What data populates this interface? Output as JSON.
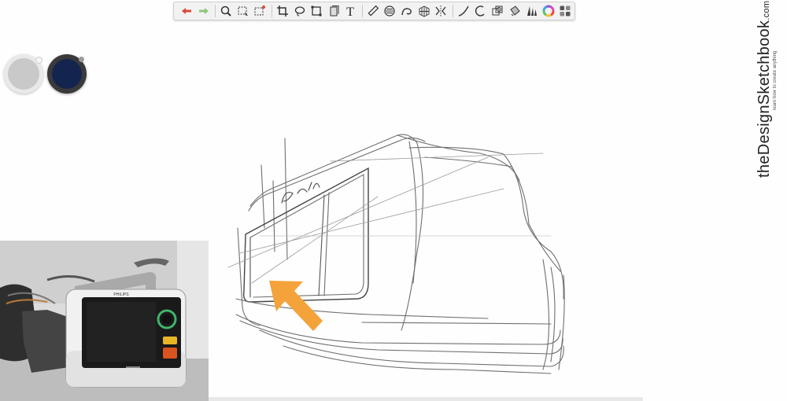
{
  "toolbar": {
    "tools": [
      {
        "name": "undo-icon",
        "color": "#d94b3a"
      },
      {
        "name": "redo-icon",
        "color": "#8cc87d"
      },
      {
        "name": "zoom-icon"
      },
      {
        "name": "selection-icon"
      },
      {
        "name": "selection-add-icon"
      },
      {
        "name": "crop-icon"
      },
      {
        "name": "lasso-icon"
      },
      {
        "name": "transform-icon"
      },
      {
        "name": "layer-icon"
      },
      {
        "name": "text-icon",
        "glyph": "T"
      },
      {
        "name": "ruler-icon"
      },
      {
        "name": "ellipse-guide-icon"
      },
      {
        "name": "french-curve-icon"
      },
      {
        "name": "perspective-grid-icon"
      },
      {
        "name": "symmetry-icon"
      },
      {
        "name": "steady-stroke-icon"
      },
      {
        "name": "circle-icon"
      },
      {
        "name": "layers-stack-icon"
      },
      {
        "name": "fill-icon"
      },
      {
        "name": "brush-library-icon"
      },
      {
        "name": "color-wheel-icon"
      },
      {
        "name": "layers-panel-icon"
      }
    ]
  },
  "swatches": [
    {
      "name": "primary-color-swatch",
      "color": "#c9c9c9",
      "ring": "#e8e8e8"
    },
    {
      "name": "secondary-color-swatch",
      "color": "#13244f",
      "ring": "#3a3a3a"
    }
  ],
  "brand": {
    "main": "theDesignSketchbook",
    "suffix": ".com",
    "tagline": "learn how to create anything"
  },
  "photo": {
    "brand_label": "PHILIPS"
  },
  "colors": {
    "arrow": "#f3a33a",
    "sketch": "#6f6f6f"
  }
}
